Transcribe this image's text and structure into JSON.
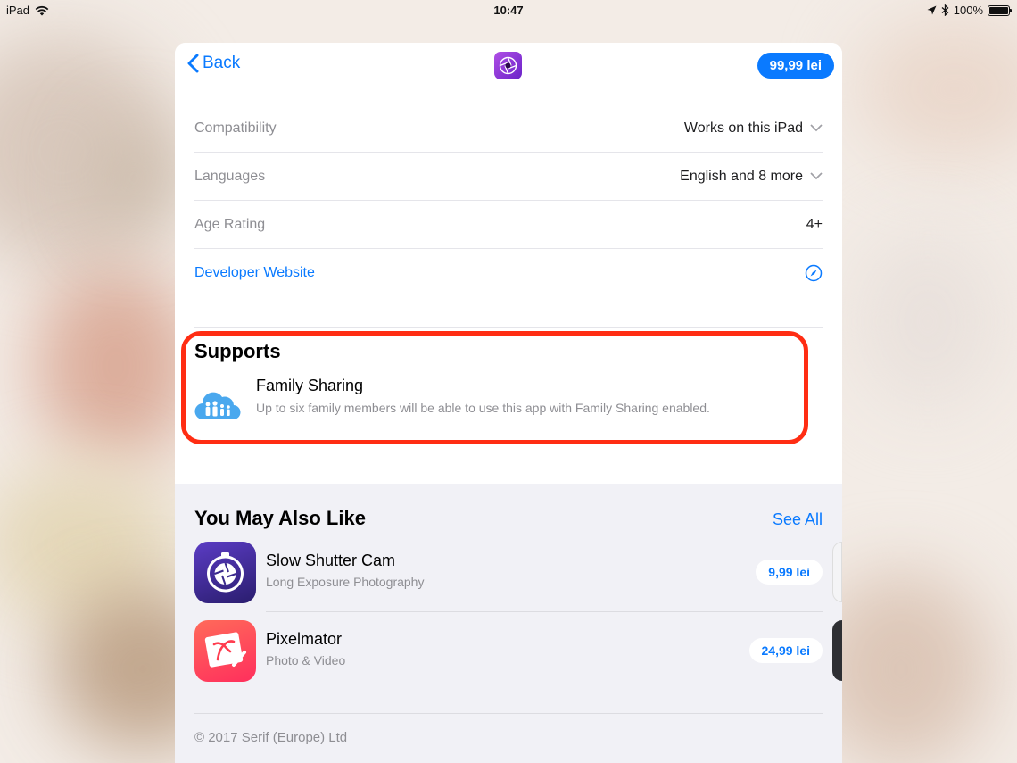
{
  "status_bar": {
    "device": "iPad",
    "time": "10:47",
    "battery": "100%"
  },
  "nav": {
    "back_label": "Back",
    "price": "99,99 lei"
  },
  "info_rows": [
    {
      "label": "Compatibility",
      "value": "Works on this iPad"
    },
    {
      "label": "Languages",
      "value": "English and 8 more"
    },
    {
      "label": "Age Rating",
      "value": "4+"
    },
    {
      "label": "Developer Website",
      "value": ""
    }
  ],
  "supports": {
    "heading": "Supports",
    "title": "Family Sharing",
    "description": "Up to six family members will be able to use this app with Family Sharing enabled."
  },
  "also_like": {
    "heading": "You May Also Like",
    "see_all": "See All",
    "apps": [
      {
        "name": "Slow Shutter Cam",
        "subtitle": "Long Exposure Photography",
        "price": "9,99 lei"
      },
      {
        "name": "Pixelmator",
        "subtitle": "Photo & Video",
        "price": "24,99 lei"
      }
    ]
  },
  "copyright": "© 2017 Serif (Europe) Ltd",
  "colors": {
    "accent": "#0a7aff",
    "highlight": "#ff2d13"
  }
}
